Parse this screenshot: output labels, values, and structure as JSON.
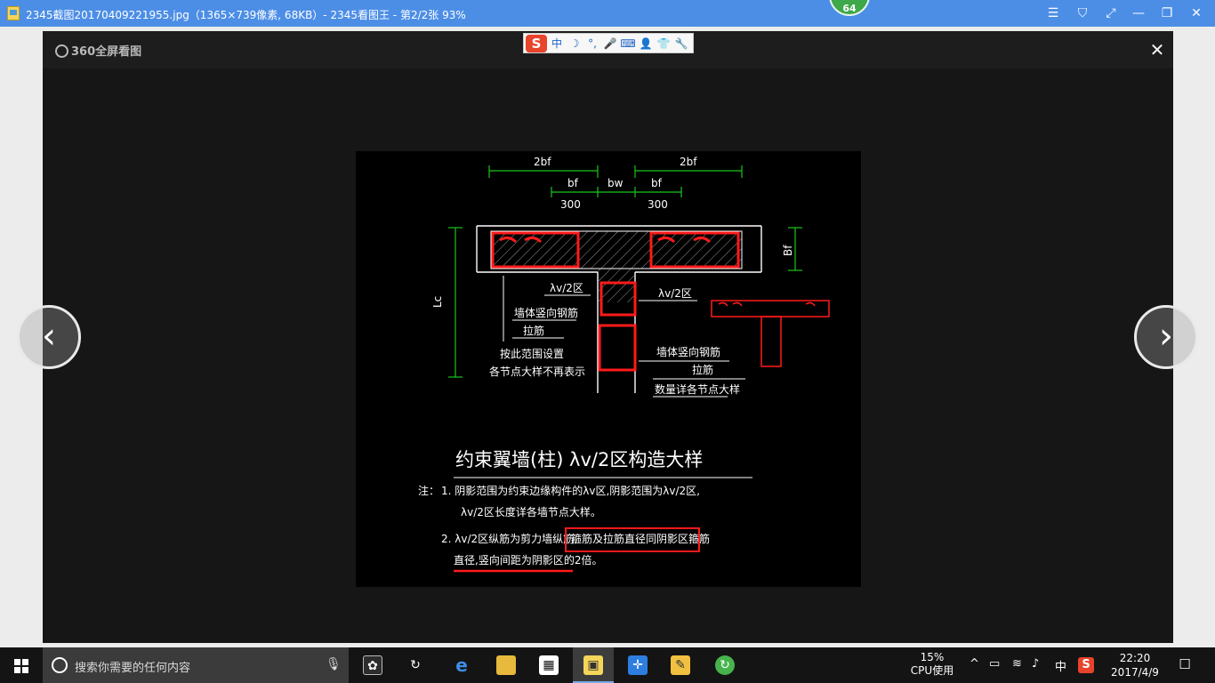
{
  "window": {
    "title": "2345截图20170409221955.jpg（1365×739像素, 68KB）- 2345看图王 - 第2/2张 93%",
    "badge": "64",
    "controls": [
      "☰",
      "⛉",
      "⤢",
      "—",
      "❐",
      "✕"
    ]
  },
  "viewer": {
    "brand": "360全屏看图",
    "close": "✕",
    "prev": "‹",
    "next": "›"
  },
  "ime": {
    "logo": "S",
    "items": [
      "中",
      "☽",
      "°,",
      "🎤",
      "⌨",
      "👤",
      "👕",
      "🔧"
    ]
  },
  "drawing": {
    "dim_2bf_left": "2bf",
    "dim_2bf_right": "2bf",
    "dim_bf_left": "bf",
    "dim_bw": "bw",
    "dim_bf_right": "bf",
    "dim_300_left": "300",
    "dim_300_right": "300",
    "dim_Lc": "Lc",
    "dim_Bf": "Bf",
    "label_zone_left": "λv/2区",
    "label_zone_right": "λv/2区",
    "label_wall_bars_left": "墙体竖向钢筋",
    "label_tie_left": "拉筋",
    "label_arrange_1": "按此范围设置",
    "label_arrange_2": "各节点大样不再表示",
    "label_wall_bars_right": "墙体竖向钢筋",
    "label_tie_right": "拉筋",
    "label_qty": "数量详各节点大样",
    "heading": "约束翼墙(柱) λv/2区构造大样",
    "note_prefix": "注：",
    "note1_line1": "1. 阴影范围为约束边缘构件的λv区,阴影范围为λv/2区,",
    "note1_line2": "λv/2区长度详各墙节点大样。",
    "note2_line1a": "2. λv/2区纵筋为剪力墙纵筋,",
    "note2_line1b": "箍筋及拉筋直径同阴影区箍筋",
    "note2_line2": "直径,竖向间距为阴影区的2倍。"
  },
  "taskbar": {
    "search_placeholder": "搜索你需要的任何内容",
    "cpu_percent": "15%",
    "cpu_label": "CPU使用",
    "ime_label": "中",
    "time": "22:20",
    "date": "2017/4/9"
  },
  "colors": {
    "titlebar": "#4c8ee6",
    "viewer_bg": "#161616",
    "cad_red": "#ff1a1a",
    "cad_green": "#19c619",
    "taskbar": "#141414"
  }
}
